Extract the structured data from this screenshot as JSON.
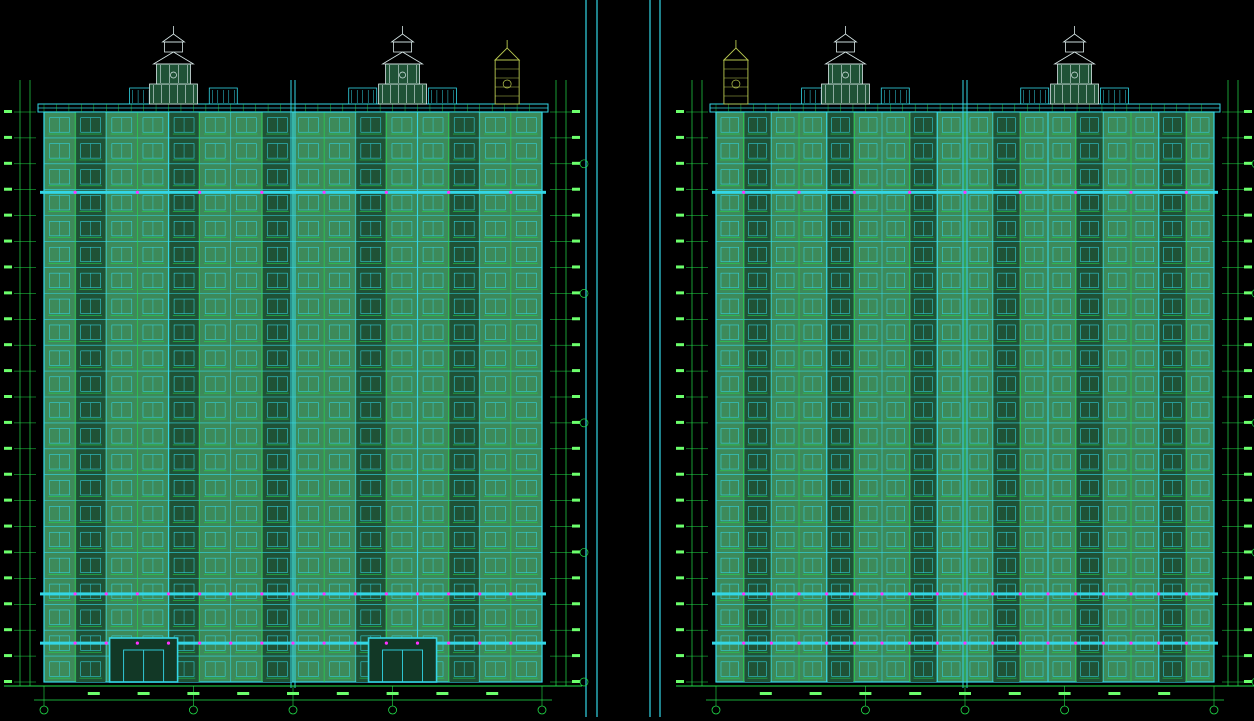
{
  "canvas": {
    "background": "#000000",
    "colors": {
      "line_cyan": "#33d6e6",
      "line_green": "#22e04a",
      "fill_green": "#3d8a5a",
      "fill_dark": "#1f5236",
      "marker_magenta": "#ff33ff",
      "tower_yellow": "#b8c850",
      "dim_text": "#6cff6c"
    }
  },
  "elevations": [
    {
      "id": "front",
      "floors": 22,
      "bays": 16,
      "entrances": 2,
      "towers": 2,
      "annex_tower": "right"
    },
    {
      "id": "rear",
      "floors": 22,
      "bays": 18,
      "entrances": 0,
      "towers": 2,
      "annex_tower": "left"
    }
  ],
  "icons": {
    "axis_marker": "circle-axis-icon",
    "level_marker": "elevation-mark-icon"
  }
}
